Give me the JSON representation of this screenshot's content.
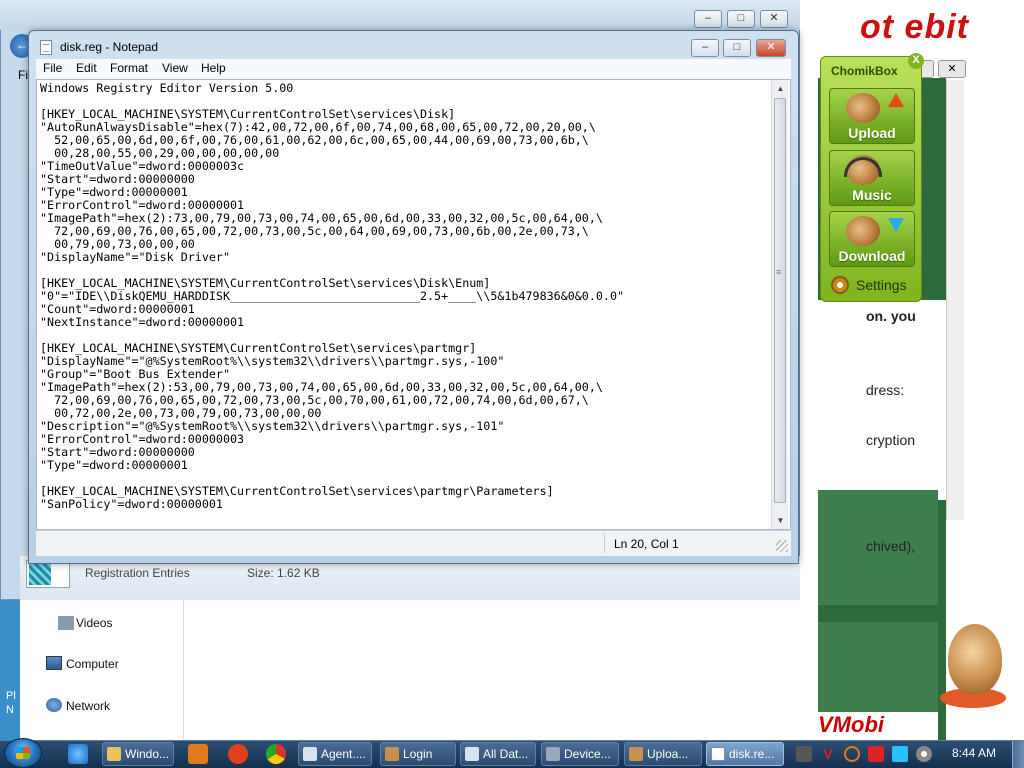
{
  "background_web": {
    "text_lines": [
      "on. you",
      "dress:",
      "cryption",
      "chived),"
    ]
  },
  "explorer": {
    "menu_fragment": "Fi",
    "nav_items": [
      "Videos",
      "Computer",
      "Network"
    ],
    "status_type": "Registration Entries",
    "status_size": "Size: 1.62 KB",
    "desktop_edge": [
      "Pl",
      "N"
    ]
  },
  "chomikbox": {
    "title": "ChomikBox",
    "close": "X",
    "buttons": [
      "Upload",
      "Music",
      "Download"
    ],
    "settings": "Settings"
  },
  "notepad": {
    "title": "disk.reg - Notepad",
    "menu": [
      "File",
      "Edit",
      "Format",
      "View",
      "Help"
    ],
    "content": "Windows Registry Editor Version 5.00\n\n[HKEY_LOCAL_MACHINE\\SYSTEM\\CurrentControlSet\\services\\Disk]\n\"AutoRunAlwaysDisable\"=hex(7):42,00,72,00,6f,00,74,00,68,00,65,00,72,00,20,00,\\\n  52,00,65,00,6d,00,6f,00,76,00,61,00,62,00,6c,00,65,00,44,00,69,00,73,00,6b,\\\n  00,28,00,55,00,29,00,00,00,00,00\n\"TimeOutValue\"=dword:0000003c\n\"Start\"=dword:00000000\n\"Type\"=dword:00000001\n\"ErrorControl\"=dword:00000001\n\"ImagePath\"=hex(2):73,00,79,00,73,00,74,00,65,00,6d,00,33,00,32,00,5c,00,64,00,\\\n  72,00,69,00,76,00,65,00,72,00,73,00,5c,00,64,00,69,00,73,00,6b,00,2e,00,73,\\\n  00,79,00,73,00,00,00\n\"DisplayName\"=\"Disk Driver\"\n\n[HKEY_LOCAL_MACHINE\\SYSTEM\\CurrentControlSet\\services\\Disk\\Enum]\n\"0\"=\"IDE\\\\DiskQEMU_HARDDISK___________________________2.5+____\\\\5&1b479836&0&0.0.0\"\n\"Count\"=dword:00000001\n\"NextInstance\"=dword:00000001\n\n[HKEY_LOCAL_MACHINE\\SYSTEM\\CurrentControlSet\\services\\partmgr]\n\"DisplayName\"=\"@%SystemRoot%\\\\system32\\\\drivers\\\\partmgr.sys,-100\"\n\"Group\"=\"Boot Bus Extender\"\n\"ImagePath\"=hex(2):53,00,79,00,73,00,74,00,65,00,6d,00,33,00,32,00,5c,00,64,00,\\\n  72,00,69,00,76,00,65,00,72,00,73,00,5c,00,70,00,61,00,72,00,74,00,6d,00,67,\\\n  00,72,00,2e,00,73,00,79,00,73,00,00,00\n\"Description\"=\"@%SystemRoot%\\\\system32\\\\drivers\\\\partmgr.sys,-101\"\n\"ErrorControl\"=dword:00000003\n\"Start\"=dword:00000000\n\"Type\"=dword:00000001\n\n[HKEY_LOCAL_MACHINE\\SYSTEM\\CurrentControlSet\\services\\partmgr\\Parameters]\n\"SanPolicy\"=dword:00000001",
    "status_position": "Ln 20, Col 1"
  },
  "taskbar": {
    "buttons": [
      "Windo...",
      "Agent....",
      "Login",
      "All Dat...",
      "Device...",
      "Uploa...",
      "disk.re..."
    ],
    "active_button": "disk.re...",
    "clock": "8:44 AM"
  },
  "colors": {
    "desktop": "#3a8fc9",
    "chomik_green": "#7fb51f",
    "taskbar": "#1f3e62"
  }
}
